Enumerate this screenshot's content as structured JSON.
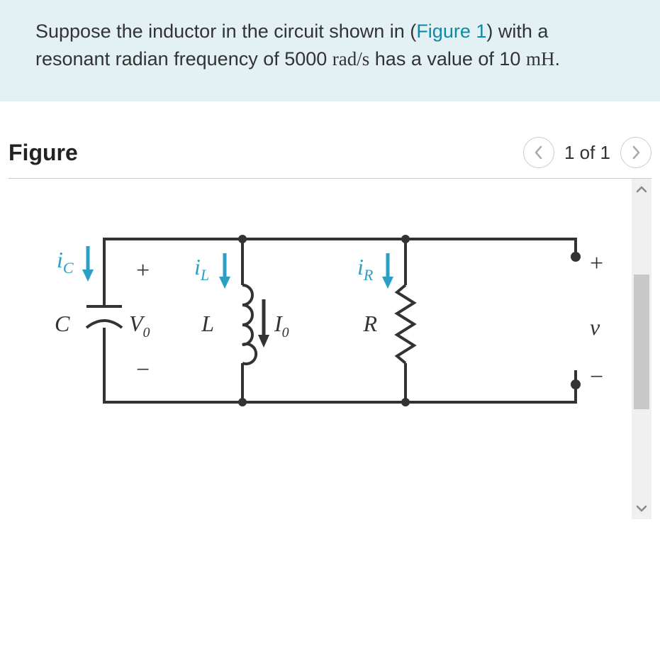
{
  "problem": {
    "text_before": "Suppose the inductor in the circuit shown in (",
    "link_text": "Figure 1",
    "text_mid": ") with a resonant radian frequency of 5000 ",
    "unit_rad": "rad/s",
    "text_after1": " has a value of 10 ",
    "unit_mh": "mH",
    "text_after2": "."
  },
  "figure": {
    "title": "Figure",
    "nav_label": "1 of 1"
  },
  "circuit": {
    "ic_label": "i",
    "ic_sub": "C",
    "il_label": "i",
    "il_sub": "L",
    "ir_label": "i",
    "ir_sub": "R",
    "C_label": "C",
    "L_label": "L",
    "R_label": "R",
    "V0_label": "V",
    "V0_sub": "0",
    "I0_label": "I",
    "I0_sub": "0",
    "v_label": "v",
    "plus": "+",
    "minus": "−"
  }
}
